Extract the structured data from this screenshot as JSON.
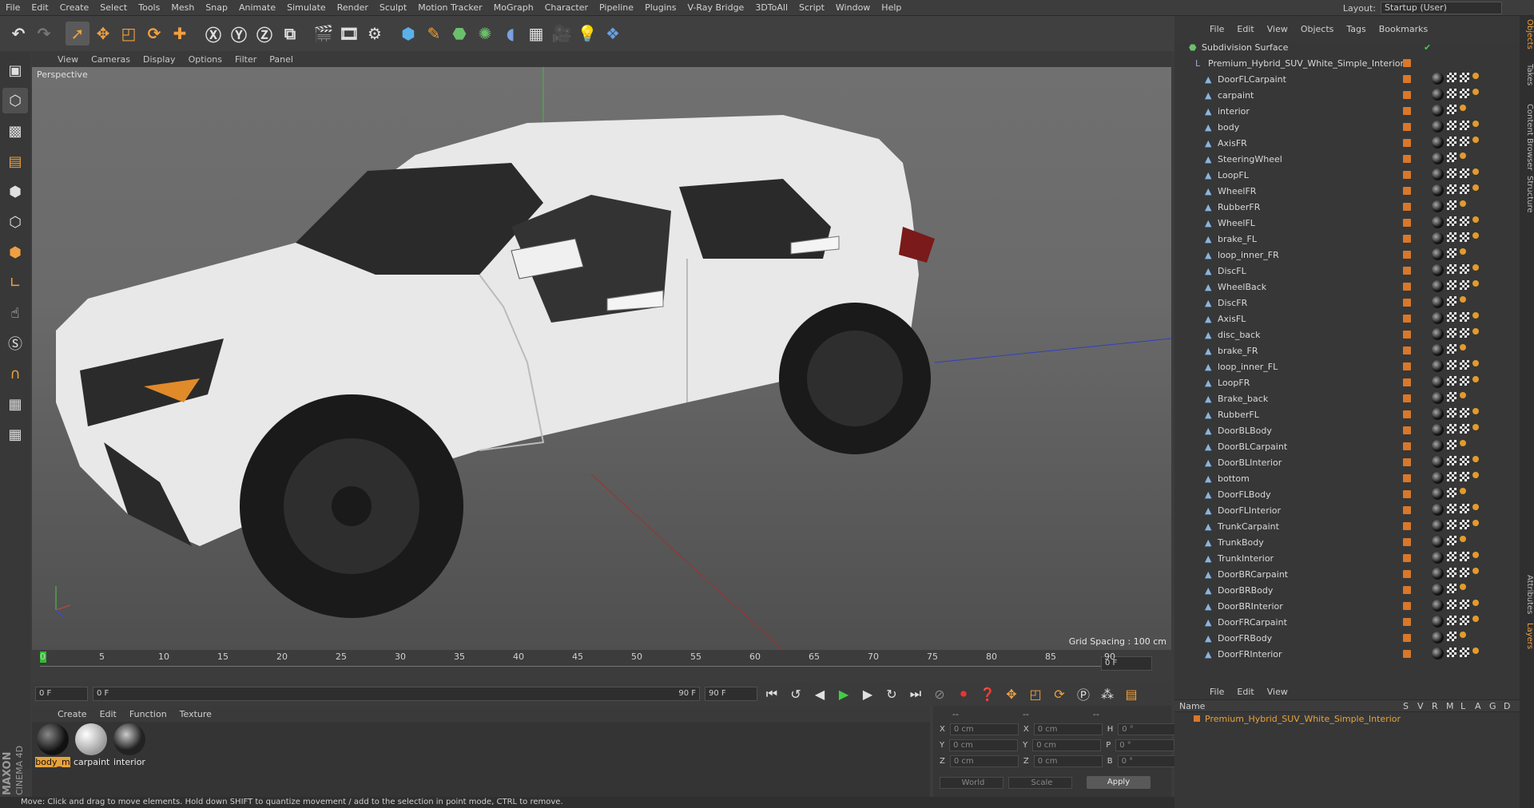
{
  "menu": [
    "File",
    "Edit",
    "Create",
    "Select",
    "Tools",
    "Mesh",
    "Snap",
    "Animate",
    "Simulate",
    "Render",
    "Sculpt",
    "Motion Tracker",
    "MoGraph",
    "Character",
    "Pipeline",
    "Plugins",
    "V-Ray Bridge",
    "3DToAll",
    "Script",
    "Window",
    "Help"
  ],
  "layout": {
    "label": "Layout:",
    "value": "Startup (User)"
  },
  "viewport": {
    "menu": [
      "View",
      "Cameras",
      "Display",
      "Options",
      "Filter",
      "Panel"
    ],
    "label": "Perspective",
    "grid_spacing": "Grid Spacing : 100 cm"
  },
  "timeline": {
    "ticks": [
      "0",
      "5",
      "10",
      "15",
      "20",
      "25",
      "30",
      "35",
      "40",
      "45",
      "50",
      "55",
      "60",
      "65",
      "70",
      "75",
      "80",
      "85",
      "90"
    ],
    "end_field": "0 F"
  },
  "controls": {
    "start": "0 F",
    "range_start": "0 F",
    "range_end": "90 F",
    "end": "90 F"
  },
  "materials": {
    "menu": [
      "Create",
      "Edit",
      "Function",
      "Texture"
    ],
    "items": [
      {
        "name": "body_m"
      },
      {
        "name": "carpaint"
      },
      {
        "name": "interior"
      }
    ]
  },
  "coords": {
    "headers": [
      "--",
      "--",
      "--"
    ],
    "rows": [
      {
        "a": "X",
        "av": "0 cm",
        "b": "X",
        "bv": "0 cm",
        "c": "H",
        "cv": "0 °"
      },
      {
        "a": "Y",
        "av": "0 cm",
        "b": "Y",
        "bv": "0 cm",
        "c": "P",
        "cv": "0 °"
      },
      {
        "a": "Z",
        "av": "0 cm",
        "b": "Z",
        "bv": "0 cm",
        "c": "B",
        "cv": "0 °"
      }
    ],
    "world": "World",
    "scale": "Scale",
    "apply": "Apply"
  },
  "status": "Move: Click and drag to move elements. Hold down SHIFT to quantize movement / add to the selection in point mode, CTRL to remove.",
  "brand": {
    "top": "MAXON",
    "bottom": "CINEMA 4D"
  },
  "objects": {
    "menu": [
      "File",
      "Edit",
      "View",
      "Objects",
      "Tags",
      "Bookmarks"
    ],
    "root": "Subdivision Surface",
    "parent": "Premium_Hybrid_SUV_White_Simple_Interior",
    "items": [
      "DoorFLCarpaint",
      "carpaint",
      "interior",
      "body",
      "AxisFR",
      "SteeringWheel",
      "LoopFL",
      "WheelFR",
      "RubberFR",
      "WheelFL",
      "brake_FL",
      "loop_inner_FR",
      "DiscFL",
      "WheelBack",
      "DiscFR",
      "AxisFL",
      "disc_back",
      "brake_FR",
      "loop_inner_FL",
      "LoopFR",
      "Brake_back",
      "RubberFL",
      "DoorBLBody",
      "DoorBLCarpaint",
      "DoorBLInterior",
      "bottom",
      "DoorFLBody",
      "DoorFLInterior",
      "TrunkCarpaint",
      "TrunkBody",
      "TrunkInterior",
      "DoorBRCarpaint",
      "DoorBRBody",
      "DoorBRInterior",
      "DoorFRCarpaint",
      "DoorFRBody",
      "DoorFRInterior"
    ]
  },
  "layers": {
    "menu": [
      "File",
      "Edit",
      "View"
    ],
    "columns": [
      "Name",
      "S",
      "V",
      "R",
      "M",
      "L",
      "A",
      "G",
      "D"
    ],
    "row": "Premium_Hybrid_SUV_White_Simple_Interior"
  },
  "side_tabs": [
    "Objects",
    "Takes",
    "Content Browser",
    "Structure",
    "Attributes",
    "Layers"
  ],
  "colors": {
    "accent": "#d9772a",
    "layer_text": "#e8a23a"
  }
}
